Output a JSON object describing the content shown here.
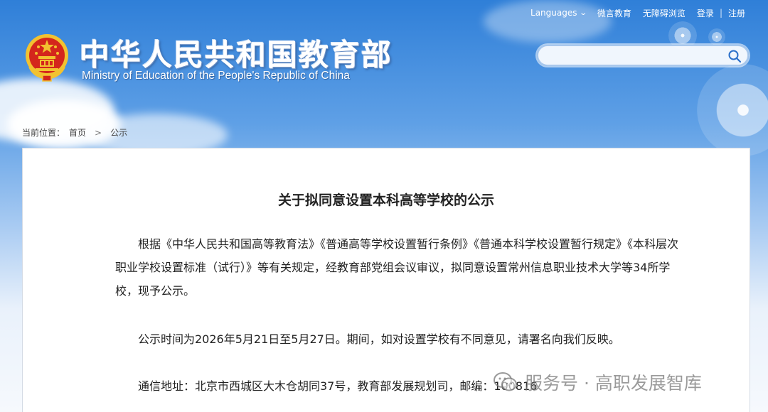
{
  "header": {
    "title_cn": "中华人民共和国教育部",
    "title_en": "Ministry of Education of the People's Republic of China"
  },
  "topnav": {
    "languages": "Languages",
    "weibo": "微言教育",
    "accessibility": "无障碍浏览",
    "login": "登录",
    "separator": "|",
    "register": "注册"
  },
  "search": {
    "placeholder": "",
    "value": ""
  },
  "breadcrumb": {
    "label": "当前位置：",
    "home": "首页",
    "arrow": ">",
    "current": "公示"
  },
  "article": {
    "title": "关于拟同意设置本科高等学校的公示",
    "paragraphs": [
      "根据《中华人民共和国高等教育法》《普通高等学校设置暂行条例》《普通本科学校设置暂行规定》《本科层次职业学校设置标准（试行）》等有关规定，经教育部党组会议审议，拟同意设置常州信息职业技术大学等34所学校，现予公示。",
      "公示时间为2026年5月21日至5月27日。期间，如对设置学校有不同意见，请署名向我们反映。",
      "通信地址：北京市西城区大木仓胡同37号，教育部发展规划司，邮编：100816"
    ]
  },
  "watermark": {
    "text": "服务号 · 高职发展智库"
  },
  "colors": {
    "sky_top": "#2f7fd8",
    "panel_bg": "#ffffff",
    "emblem_red": "#d4261c",
    "emblem_gold": "#f2c230"
  }
}
